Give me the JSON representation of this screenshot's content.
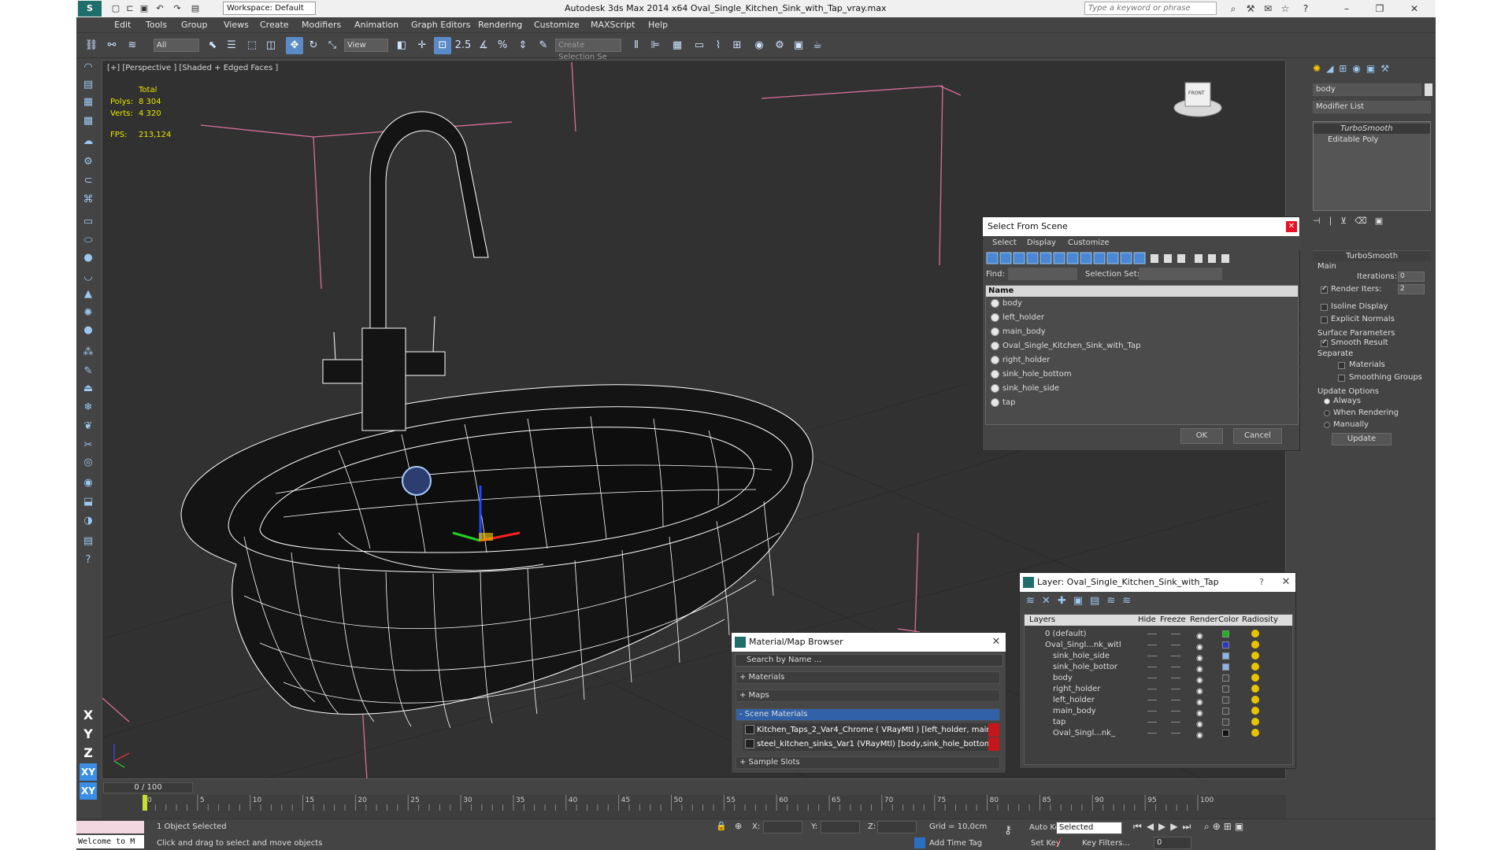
{
  "titlebar": {
    "workspace": "Workspace: Default",
    "title": "Autodesk 3ds Max  2014 x64      Oval_Single_Kitchen_Sink_with_Tap_vray.max",
    "search_placeholder": "Type a keyword or phrase"
  },
  "menu": [
    "Edit",
    "Tools",
    "Group",
    "Views",
    "Create",
    "Modifiers",
    "Animation",
    "Graph Editors",
    "Rendering",
    "Customize",
    "MAXScript",
    "Help"
  ],
  "toolbar": {
    "filter": "All",
    "ref_coord": "View",
    "snap_value": "2.5",
    "selection_set_placeholder": "Create Selection Se"
  },
  "viewport": {
    "label": "[+] [Perspective ] [Shaded + Edged Faces ]",
    "stats": {
      "total_label": "Total",
      "polys_label": "Polys:",
      "polys": "8 304",
      "verts_label": "Verts:",
      "verts": "4 320",
      "fps_label": "FPS:",
      "fps": "213,124"
    },
    "viewcube_front": "FRONT",
    "viewcube_left": "LEFT"
  },
  "select_from_scene": {
    "title": "Select From Scene",
    "menus": [
      "Select",
      "Display",
      "Customize"
    ],
    "find_label": "Find:",
    "selection_set_label": "Selection Set:",
    "column": "Name",
    "objects": [
      "body",
      "left_holder",
      "main_body",
      "Oval_Single_Kitchen_Sink_with_Tap",
      "right_holder",
      "sink_hole_bottom",
      "sink_hole_side",
      "tap"
    ],
    "ok": "OK",
    "cancel": "Cancel"
  },
  "command_panel": {
    "object_name": "body",
    "modifier_list": "Modifier List",
    "stack": [
      "TurboSmooth",
      "Editable Poly"
    ],
    "turbosmooth_title": "TurboSmooth",
    "main_label": "Main",
    "iterations_label": "Iterations:",
    "iterations": "0",
    "render_iters_label": "Render Iters:",
    "render_iters": "2",
    "isoline": "Isoline Display",
    "explicit_normals": "Explicit Normals",
    "surface_params": "Surface Parameters",
    "smooth_result": "Smooth Result",
    "separate": "Separate",
    "materials": "Materials",
    "smoothing_groups": "Smoothing Groups",
    "update_options": "Update Options",
    "always": "Always",
    "when_rendering": "When Rendering",
    "manually": "Manually",
    "update": "Update"
  },
  "material_browser": {
    "title": "Material/Map Browser",
    "search": "Search by Name ...",
    "categories": [
      "+ Materials",
      "+ Maps",
      "- Scene Materials",
      "+ Sample Slots"
    ],
    "scene_materials": [
      "Kitchen_Taps_2_Var4_Chrome  ( VRayMtl )  [left_holder, main_...",
      "steel_kitchen_sinks_Var1 (VRayMtl) [body,sink_hole_bottom..."
    ]
  },
  "layer_dialog": {
    "title": "Layer: Oval_Single_Kitchen_Sink_with_Tap",
    "help": "?",
    "columns": [
      "Layers",
      "Hide",
      "Freeze",
      "Render",
      "Color",
      "Radiosity"
    ],
    "rows": [
      {
        "name": "0 (default)",
        "indent": 1,
        "color": "#18b818"
      },
      {
        "name": "Oval_Singl...nk_witl",
        "indent": 1,
        "color": "#2838c8"
      },
      {
        "name": "sink_hole_side",
        "indent": 2,
        "color": "#8fb4e6"
      },
      {
        "name": "sink_hole_bottor",
        "indent": 2,
        "color": "#8fb4e6"
      },
      {
        "name": "body",
        "indent": 2,
        "color": "#444444"
      },
      {
        "name": "right_holder",
        "indent": 2,
        "color": "#444444"
      },
      {
        "name": "left_holder",
        "indent": 2,
        "color": "#444444"
      },
      {
        "name": "main_body",
        "indent": 2,
        "color": "#444444"
      },
      {
        "name": "tap",
        "indent": 2,
        "color": "#444444"
      },
      {
        "name": "Oval_Singl...nk_",
        "indent": 2,
        "color": "#111111"
      }
    ]
  },
  "timeline": {
    "frame": "0 / 100",
    "ticks": [
      "0",
      "5",
      "10",
      "15",
      "20",
      "25",
      "30",
      "35",
      "40",
      "45",
      "50",
      "55",
      "60",
      "65",
      "70",
      "75",
      "80",
      "85",
      "90",
      "95",
      "100"
    ]
  },
  "status": {
    "welcome": "Welcome to M",
    "selected": "1 Object Selected",
    "hint": "Click and drag to select and move objects",
    "x_label": "X:",
    "y_label": "Y:",
    "z_label": "Z:",
    "grid": "Grid = 10,0cm",
    "add_time_tag": "Add Time Tag",
    "auto_key": "Auto Key",
    "set_key": "Set Key",
    "selected_drop": "Selected",
    "key_filters": "Key Filters...",
    "frame_field": "0"
  }
}
